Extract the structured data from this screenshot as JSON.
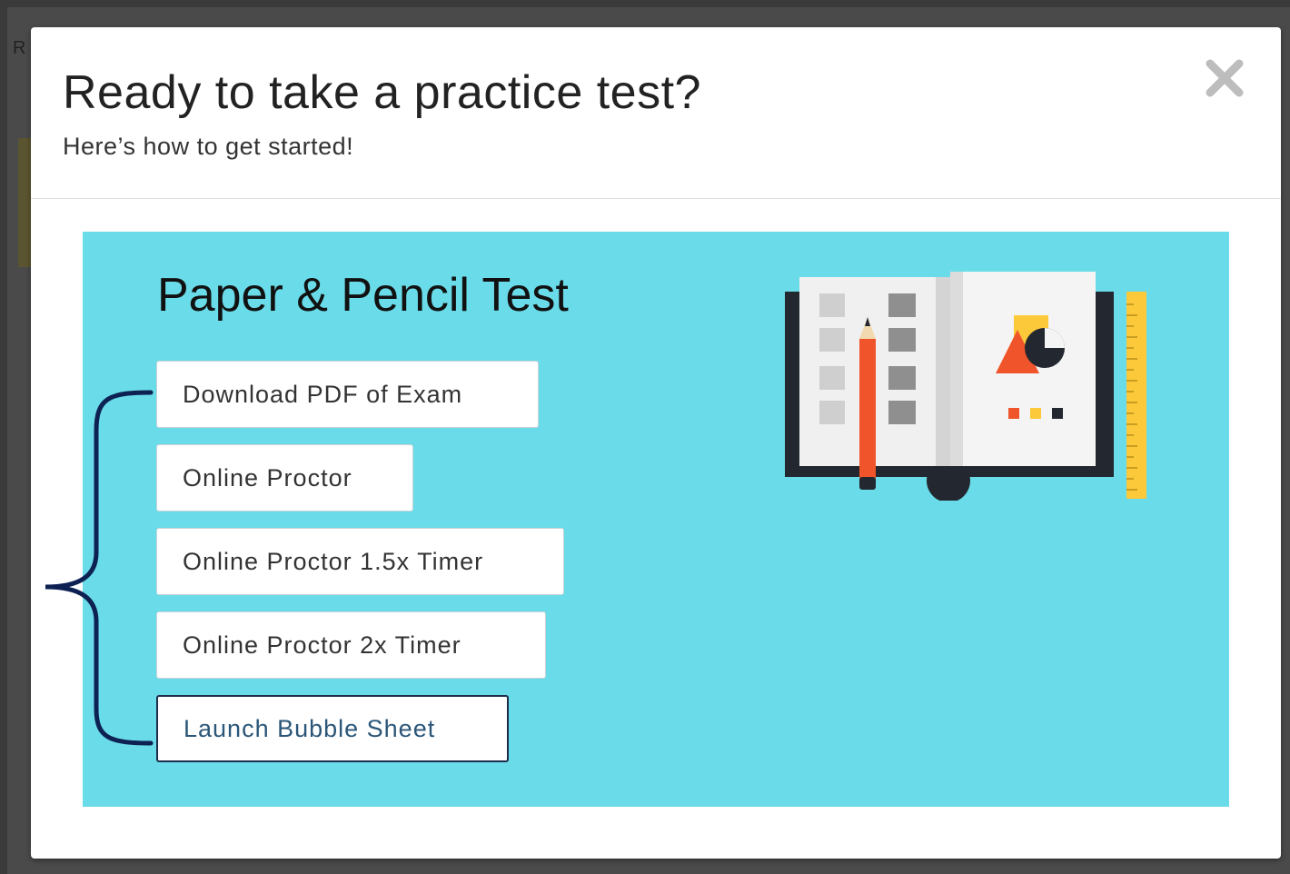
{
  "background": {
    "partial_letter": "R"
  },
  "modal": {
    "title": "Ready to take a practice test?",
    "subtitle": "Here’s how to get started!",
    "close_glyph": "✕"
  },
  "panel": {
    "heading": "Paper & Pencil Test",
    "options": [
      {
        "label": "Download PDF of Exam"
      },
      {
        "label": "Online Proctor"
      },
      {
        "label": "Online Proctor 1.5x Timer"
      },
      {
        "label": "Online Proctor 2x Timer"
      },
      {
        "label": "Launch Bubble Sheet"
      }
    ],
    "illustration": {
      "icon": "open-book-with-pencil-and-ruler-icon"
    }
  },
  "annotation": {
    "icon": "curly-bracket-icon",
    "color": "#0d2152"
  },
  "colors": {
    "panel_bg": "#6adbe8",
    "primary_text": "#2b5678",
    "overlay": "#4a4a4a"
  }
}
